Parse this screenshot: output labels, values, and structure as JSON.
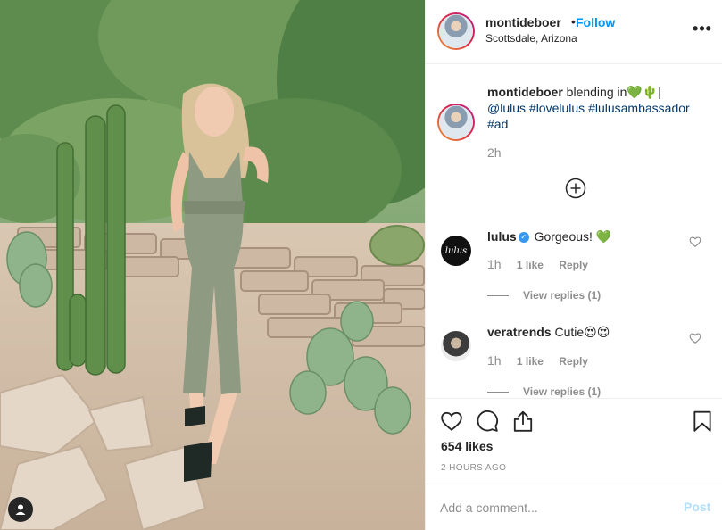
{
  "post": {
    "username": "montideboer",
    "separator": "•",
    "follow_label": "Follow",
    "location": "Scottsdale, Arizona",
    "more_label": "•••"
  },
  "caption": {
    "username": "montideboer",
    "text": "blending in💚🌵|",
    "mention": "@lulus",
    "hashtags": [
      "#lovelulus",
      "#lulusambassador",
      "#ad"
    ],
    "time": "2h"
  },
  "comments": [
    {
      "username": "lulus",
      "verified": true,
      "avatar_text": "lulus",
      "text": "Gorgeous! 💚",
      "time": "1h",
      "likes": "1 like",
      "reply_label": "Reply",
      "view_replies": "View replies (1)"
    },
    {
      "username": "veratrends",
      "verified": false,
      "text": "Cutie😍😍",
      "time": "1h",
      "likes": "1 like",
      "reply_label": "Reply",
      "view_replies": "View replies (1)"
    }
  ],
  "actions": {
    "icons": [
      "heart-icon",
      "comment-icon",
      "share-icon",
      "bookmark-icon"
    ],
    "likes": "654 likes",
    "post_time": "2 HOURS AGO"
  },
  "add_comment": {
    "placeholder": "Add a comment...",
    "post_label": "Post"
  },
  "colors": {
    "link_blue": "#0095f6",
    "hashtag_blue": "#00376b",
    "muted_gray": "#8e8e8e",
    "post_disabled": "#b2dffc",
    "verified_blue": "#3897f0"
  }
}
